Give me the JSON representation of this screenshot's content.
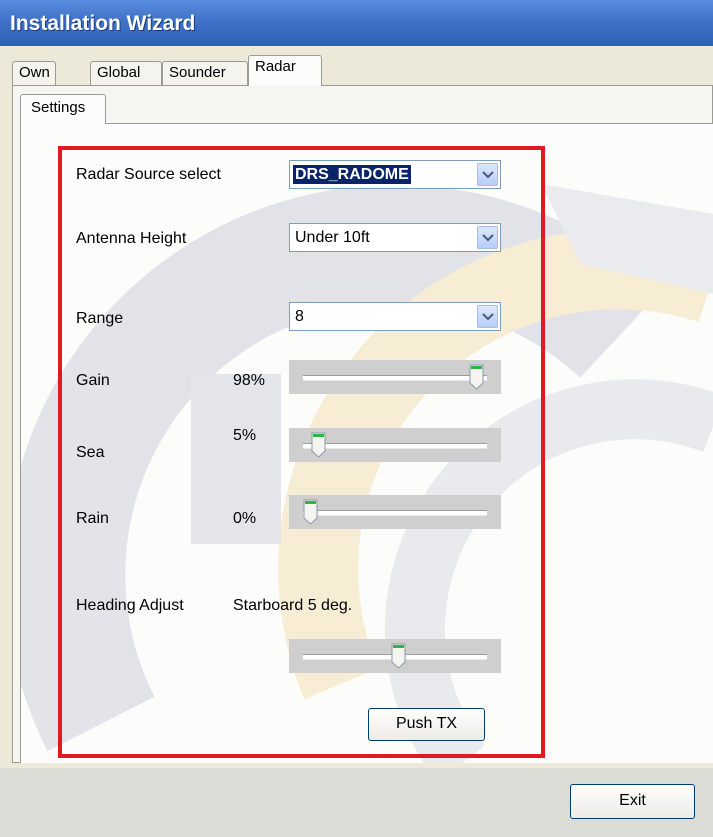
{
  "window": {
    "title": "Installation Wizard"
  },
  "tabs": [
    "Own",
    "Global",
    "Sounder",
    "Radar"
  ],
  "active_tab": "Radar",
  "subtab": "Settings",
  "radar": {
    "source": {
      "label": "Radar Source select",
      "value": "DRS_RADOME"
    },
    "antenna": {
      "label": "Antenna Height",
      "value": "Under 10ft"
    },
    "range": {
      "label": "Range",
      "value": "8"
    },
    "gain": {
      "label": "Gain",
      "percent_text": "98%",
      "level": 0.98
    },
    "sea": {
      "label": "Sea",
      "percent_text": "5%",
      "level": 0.05
    },
    "rain": {
      "label": "Rain",
      "percent_text": "0%",
      "level": 0.0
    },
    "heading": {
      "label": "Heading Adjust",
      "value_text": "Starboard 5 deg.",
      "level": 0.52
    },
    "push_tx_label": "Push TX"
  },
  "exit_label": "Exit",
  "colors": {
    "titlebar": "#3f72c8",
    "highlight": "#e01a22",
    "thumb_accent": "#2fb44a"
  }
}
